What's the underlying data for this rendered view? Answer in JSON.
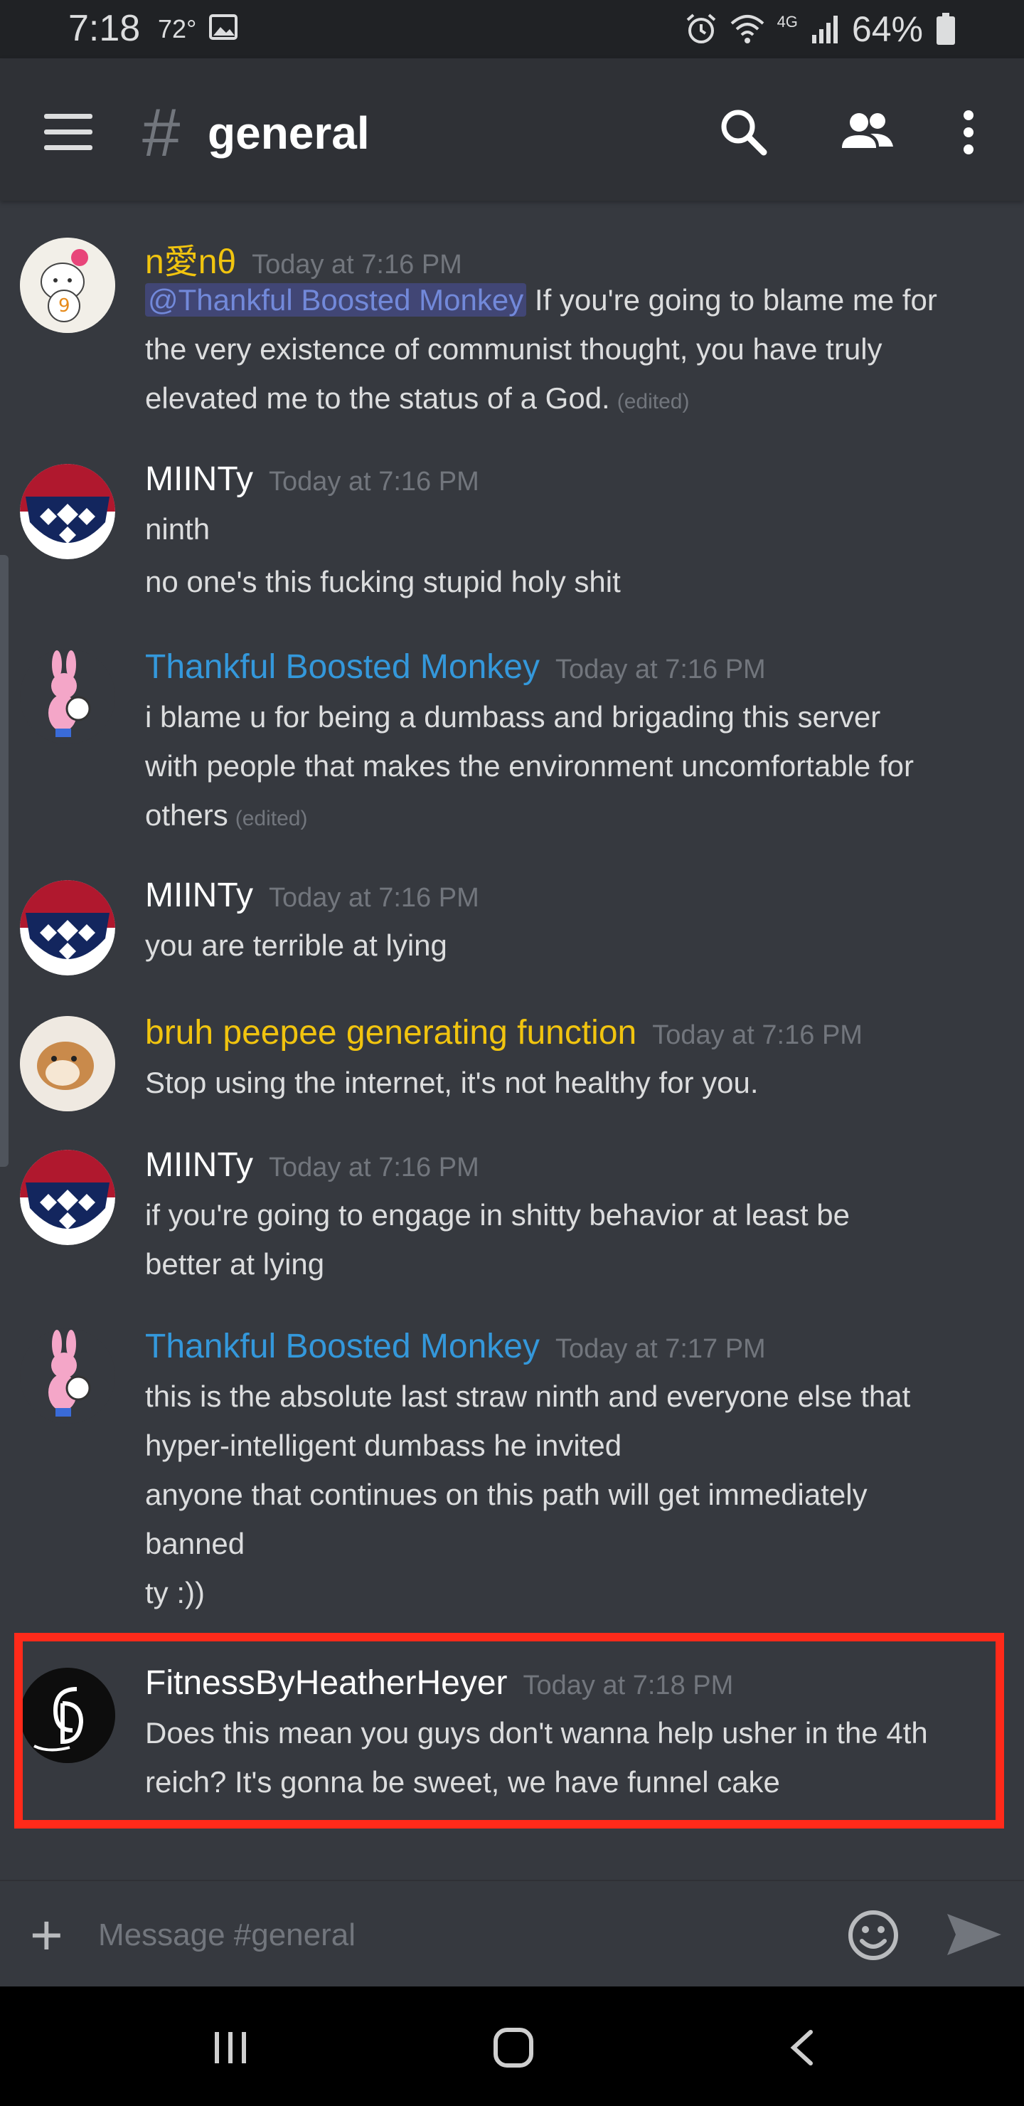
{
  "status_bar": {
    "time": "7:18",
    "temperature": "72°",
    "battery": "64%",
    "network": "4G"
  },
  "header": {
    "hash": "#",
    "channel": "general"
  },
  "messages": [
    {
      "author": "n愛nθ",
      "author_color": "#f1c40f",
      "timestamp": "Today at 7:16 PM",
      "mention": "@Thankful Boosted Monkey",
      "lines": [
        " If you're going to blame me for",
        "the very existence of communist thought, you have truly",
        "elevated me to the status of a God."
      ],
      "edited": "(edited)"
    },
    {
      "author": "MIINTy",
      "author_color": "#ffffff",
      "timestamp": "Today at 7:16 PM",
      "lines": [
        "ninth",
        "no one's this fucking stupid holy shit"
      ]
    },
    {
      "author": "Thankful Boosted Monkey",
      "author_color": "#3498db",
      "timestamp": "Today at 7:16 PM",
      "lines": [
        "i blame u for being a dumbass and brigading this server",
        "with people that makes the environment uncomfortable for",
        "others"
      ],
      "edited": "(edited)"
    },
    {
      "author": "MIINTy",
      "author_color": "#ffffff",
      "timestamp": "Today at 7:16 PM",
      "lines": [
        "you are terrible at lying"
      ]
    },
    {
      "author": "bruh peepee generating function",
      "author_color": "#f1c40f",
      "timestamp": "Today at 7:16 PM",
      "lines": [
        "Stop using the internet, it's not healthy for you."
      ]
    },
    {
      "author": "MIINTy",
      "author_color": "#ffffff",
      "timestamp": "Today at 7:16 PM",
      "lines": [
        "if you're going to engage in shitty behavior at least be",
        "better at lying"
      ]
    },
    {
      "author": "Thankful Boosted Monkey",
      "author_color": "#3498db",
      "timestamp": "Today at 7:17 PM",
      "lines": [
        "this is the absolute last straw ninth and everyone else that",
        "hyper-intelligent dumbass he invited",
        "anyone that continues on this path will get immediately",
        "banned",
        "ty :))"
      ]
    },
    {
      "author": "FitnessByHeatherHeyer",
      "author_color": "#ffffff",
      "timestamp": "Today at 7:18 PM",
      "lines": [
        "Does this mean you guys don't wanna help usher in the 4th",
        "reich? It's gonna be sweet, we have funnel cake"
      ]
    }
  ],
  "input": {
    "placeholder": "Message #general",
    "value": ""
  },
  "colors": {
    "background": "#36393f",
    "header": "#2f3136",
    "highlight": "#ff2a1a",
    "mention_bg": "#414675",
    "mention_text": "#7289da"
  }
}
